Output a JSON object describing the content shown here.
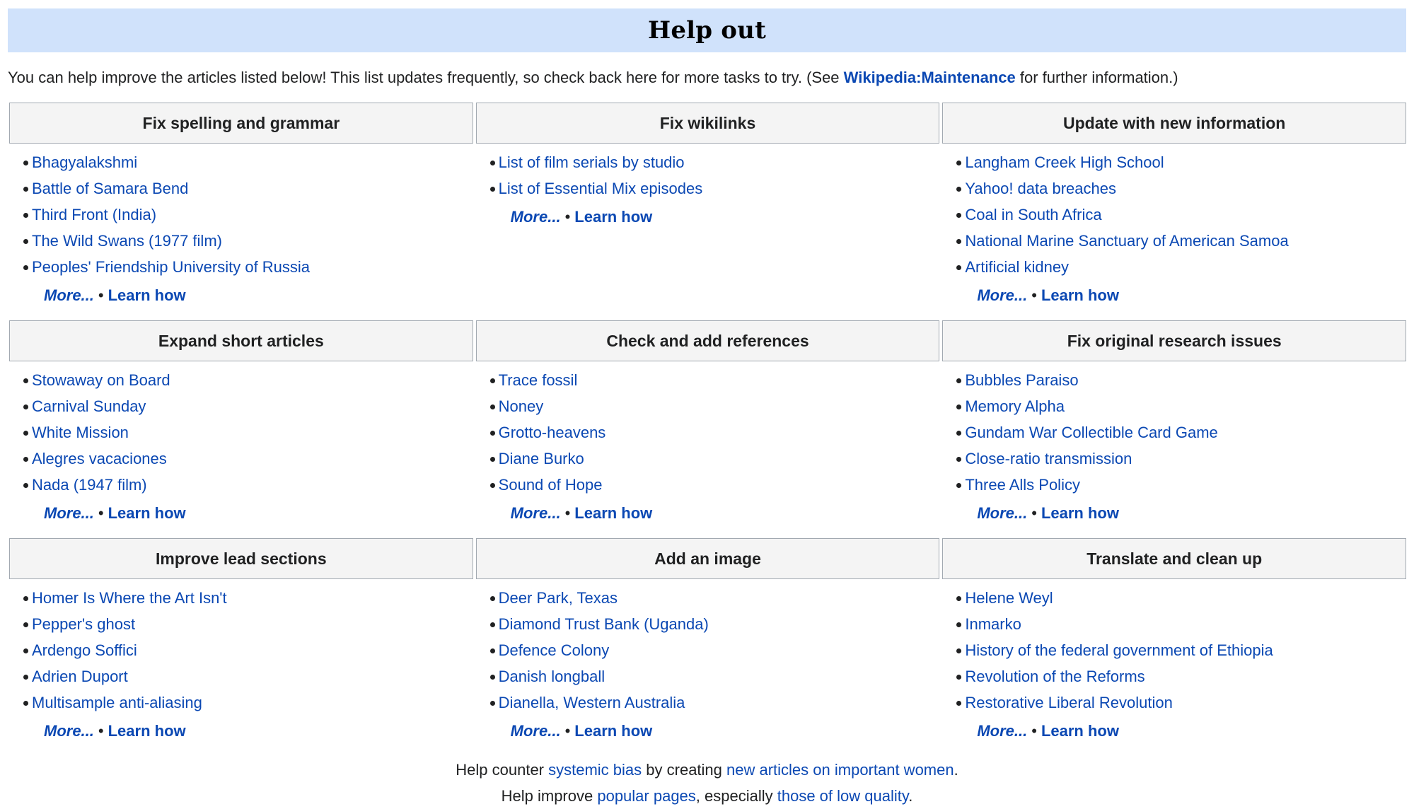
{
  "header": {
    "title": "Help out"
  },
  "intro": {
    "before": "You can help improve the articles listed below! This list updates frequently, so check back here for more tasks to try. (See ",
    "link": "Wikipedia:Maintenance",
    "after": " for further information.)"
  },
  "sections": [
    {
      "title": "Fix spelling and grammar",
      "items": [
        "Bhagyalakshmi",
        "Battle of Samara Bend",
        "Third Front (India)",
        "The Wild Swans (1977 film)",
        "Peoples' Friendship University of Russia"
      ],
      "more": "More...",
      "learn": "Learn how"
    },
    {
      "title": "Fix wikilinks",
      "items": [
        "List of film serials by studio",
        "List of Essential Mix episodes"
      ],
      "more": "More...",
      "learn": "Learn how"
    },
    {
      "title": "Update with new information",
      "items": [
        "Langham Creek High School",
        "Yahoo! data breaches",
        "Coal in South Africa",
        "National Marine Sanctuary of American Samoa",
        "Artificial kidney"
      ],
      "more": "More...",
      "learn": "Learn how"
    },
    {
      "title": "Expand short articles",
      "items": [
        "Stowaway on Board",
        "Carnival Sunday",
        "White Mission",
        "Alegres vacaciones",
        "Nada (1947 film)"
      ],
      "more": "More...",
      "learn": "Learn how"
    },
    {
      "title": "Check and add references",
      "items": [
        "Trace fossil",
        "Noney",
        "Grotto-heavens",
        "Diane Burko",
        "Sound of Hope"
      ],
      "more": "More...",
      "learn": "Learn how"
    },
    {
      "title": "Fix original research issues",
      "items": [
        "Bubbles Paraiso",
        "Memory Alpha",
        "Gundam War Collectible Card Game",
        "Close-ratio transmission",
        "Three Alls Policy"
      ],
      "more": "More...",
      "learn": "Learn how"
    },
    {
      "title": "Improve lead sections",
      "items": [
        "Homer Is Where the Art Isn't",
        "Pepper's ghost",
        "Ardengo Soffici",
        "Adrien Duport",
        "Multisample anti-aliasing"
      ],
      "more": "More...",
      "learn": "Learn how"
    },
    {
      "title": "Add an image",
      "items": [
        "Deer Park, Texas",
        "Diamond Trust Bank (Uganda)",
        "Defence Colony",
        "Danish longball",
        "Dianella, Western Australia"
      ],
      "more": "More...",
      "learn": "Learn how"
    },
    {
      "title": "Translate and clean up",
      "items": [
        "Helene Weyl",
        "Inmarko",
        "History of the federal government of Ethiopia",
        "Revolution of the Reforms",
        "Restorative Liberal Revolution"
      ],
      "more": "More...",
      "learn": "Learn how"
    }
  ],
  "bottom": {
    "line1": {
      "t1": "Help counter ",
      "l1": "systemic bias",
      "t2": " by creating ",
      "l2": "new articles on important women",
      "t3": "."
    },
    "line2": {
      "t1": "Help improve ",
      "l1": "popular pages",
      "t2": ", especially ",
      "l2": "those of low quality",
      "t3": "."
    }
  },
  "colors": {
    "link": "#0b48b3",
    "title_bar": "#d0e2fb",
    "header_bg": "#f4f4f4",
    "border": "#a2a9b1"
  },
  "icons": {
    "bullet": "bullet-icon",
    "separator": "middle-dot"
  }
}
